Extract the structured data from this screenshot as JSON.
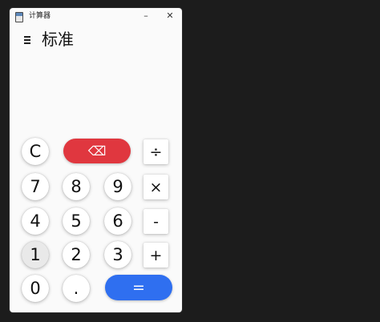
{
  "window": {
    "title": "计算器",
    "minimize_glyph": "–",
    "close_glyph": "✕"
  },
  "header": {
    "menu_icon": "hamburger-menu-icon",
    "mode_title": "标准"
  },
  "keys": {
    "clear": "C",
    "backspace": "⌫",
    "divide": "÷",
    "seven": "7",
    "eight": "8",
    "nine": "9",
    "multiply": "×",
    "four": "4",
    "five": "5",
    "six": "6",
    "subtract": "-",
    "one": "1",
    "two": "2",
    "three": "3",
    "add": "+",
    "zero": "0",
    "decimal": ".",
    "equals": "="
  },
  "colors": {
    "backspace_bg": "#e0373f",
    "equals_bg": "#2f6ff0",
    "window_bg": "#fafafa"
  }
}
